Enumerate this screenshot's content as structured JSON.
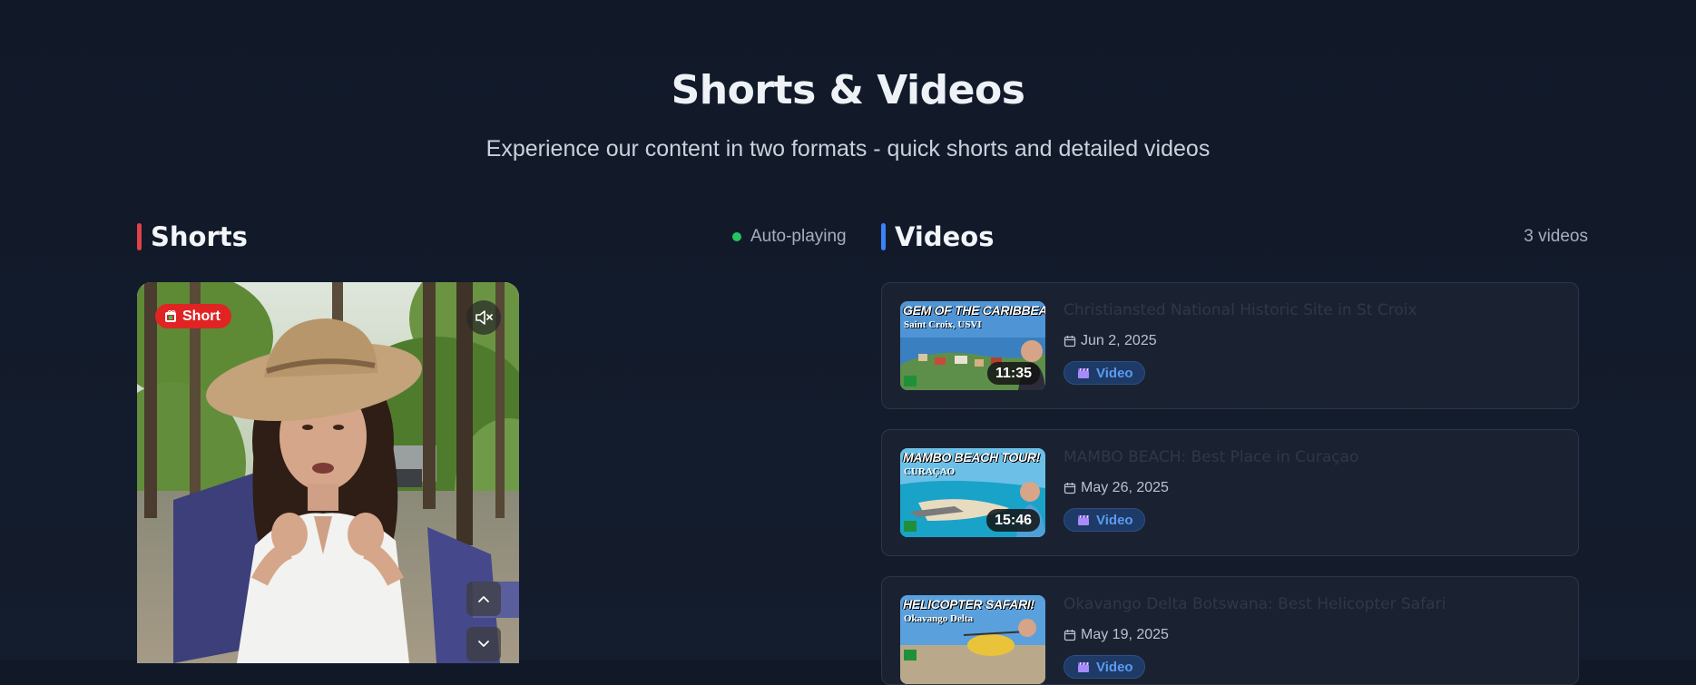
{
  "hero": {
    "title": "Shorts & Videos",
    "subtitle": "Experience our content in two formats - quick shorts and detailed videos"
  },
  "shorts": {
    "heading": "Shorts",
    "status": "Auto-playing",
    "accent": "#e0424a",
    "player": {
      "badge_label": "Short",
      "mute_icon": "volume-mute-icon",
      "prev_icon": "chevron-up-icon",
      "next_icon": "chevron-down-icon"
    }
  },
  "videos": {
    "heading": "Videos",
    "count_label": "3 videos",
    "accent": "#3b82f6",
    "items": [
      {
        "title": "Christiansted National Historic Site in St Croix",
        "date": "Jun 2, 2025",
        "type_label": "Video",
        "duration": "11:35",
        "thumb_headline": "GEM OF THE CARIBBEAN!",
        "thumb_sub": "Saint Croix, USVI"
      },
      {
        "title": "MAMBO BEACH: Best Place in Curaçao",
        "date": "May 26, 2025",
        "type_label": "Video",
        "duration": "15:46",
        "thumb_headline": "MAMBO BEACH TOUR!",
        "thumb_sub": "CURAÇAO"
      },
      {
        "title": "Okavango Delta Botswana: Best Helicopter Safari",
        "date": "May 19, 2025",
        "type_label": "Video",
        "duration": "",
        "thumb_headline": "HELICOPTER SAFARI!",
        "thumb_sub": "Okavango Delta"
      }
    ]
  }
}
